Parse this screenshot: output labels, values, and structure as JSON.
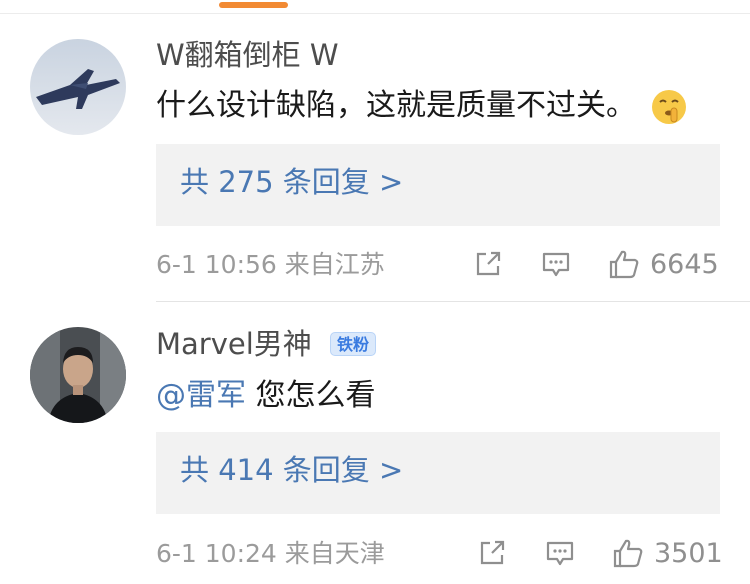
{
  "comments": [
    {
      "username": "W翻箱倒柜 W",
      "text": "什么设计缺陷，这就是质量不过关。",
      "emoji": "shushing-face",
      "reply_label": "共 275 条回复 >",
      "meta": "6-1 10:56 来自江苏",
      "like_count": "6645"
    },
    {
      "username": "Marvel男神",
      "badge": "铁粉",
      "mention": "@雷军",
      "text": " 您怎么看",
      "reply_label": "共 414 条回复 >",
      "meta": "6-1 10:24 来自天津",
      "like_count": "3501"
    }
  ],
  "icons": {
    "share": "share-icon",
    "comment": "comment-icon",
    "like": "thumbs-up-icon"
  },
  "colors": {
    "accent": "#f28a33",
    "link": "#4a78b3",
    "badge": "#3a7be0"
  }
}
